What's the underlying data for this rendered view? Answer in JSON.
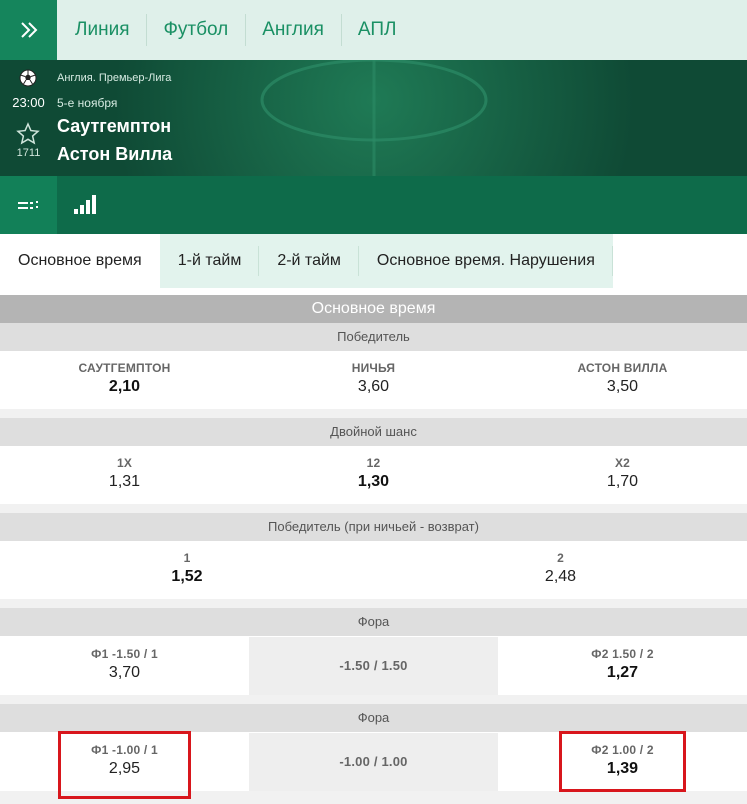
{
  "breadcrumbs": [
    "Линия",
    "Футбол",
    "Англия",
    "АПЛ"
  ],
  "match": {
    "league": "Англия. Премьер-Лига",
    "date": "5-е ноября",
    "time": "23:00",
    "match_id": "1711",
    "home_team": "Саутгемптон",
    "away_team": "Астон Вилла"
  },
  "tabs": [
    {
      "label": "Основное время",
      "active": true
    },
    {
      "label": "1-й тайм",
      "active": false
    },
    {
      "label": "2-й тайм",
      "active": false
    },
    {
      "label": "Основное время. Нарушения",
      "active": false
    }
  ],
  "section_title": "Основное время",
  "markets": [
    {
      "title": "Победитель",
      "outcomes": [
        {
          "label": "САУТГЕМПТОН",
          "odd": "2,10",
          "favorite": true
        },
        {
          "label": "НИЧЬЯ",
          "odd": "3,60",
          "favorite": false
        },
        {
          "label": "АСТОН ВИЛЛА",
          "odd": "3,50",
          "favorite": false
        }
      ]
    },
    {
      "title": "Двойной шанс",
      "outcomes": [
        {
          "label": "1X",
          "odd": "1,31",
          "favorite": false
        },
        {
          "label": "12",
          "odd": "1,30",
          "favorite": true
        },
        {
          "label": "X2",
          "odd": "1,70",
          "favorite": false
        }
      ]
    },
    {
      "title": "Победитель (при ничьей - возврат)",
      "outcomes": [
        {
          "label": "1",
          "odd": "1,52",
          "favorite": true
        },
        {
          "label": "2",
          "odd": "2,48",
          "favorite": false
        }
      ]
    },
    {
      "title": "Фора",
      "handicap_line": "-1.50 / 1.50",
      "outcomes": [
        {
          "label": "Ф1 -1.50 / 1",
          "odd": "3,70",
          "favorite": false
        },
        {
          "label": "Ф2 1.50 / 2",
          "odd": "1,27",
          "favorite": true
        }
      ]
    },
    {
      "title": "Фора",
      "handicap_line": "-1.00 / 1.00",
      "outcomes": [
        {
          "label": "Ф1 -1.00 / 1",
          "odd": "2,95",
          "favorite": false,
          "highlighted": true
        },
        {
          "label": "Ф2 1.00 / 2",
          "odd": "1,39",
          "favorite": true,
          "highlighted": true
        }
      ]
    }
  ],
  "colors": {
    "brand_green": "#15855c",
    "header_dark": "#104a35",
    "highlight_red": "#d8161c"
  }
}
